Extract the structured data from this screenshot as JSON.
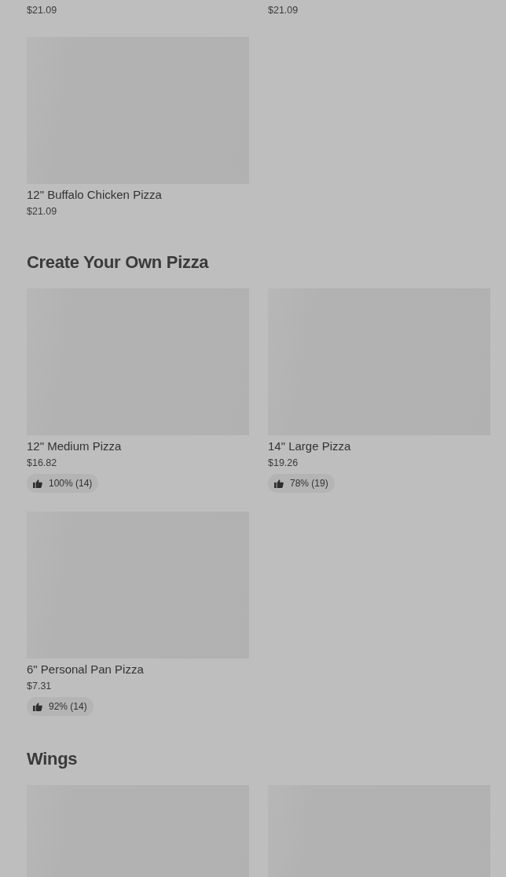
{
  "sections": [
    {
      "items": [
        {
          "image": false,
          "price": "$21.09"
        },
        {
          "image": false,
          "price": "$21.09"
        },
        {
          "image": true,
          "title": "12\" Buffalo Chicken Pizza",
          "price": "$21.09"
        }
      ]
    },
    {
      "heading": "Create Your Own Pizza",
      "items": [
        {
          "image": true,
          "title": "12\" Medium Pizza",
          "price": "$16.82",
          "rating": "100% (14)"
        },
        {
          "image": true,
          "title": "14\" Large Pizza",
          "price": "$19.26",
          "rating": "78% (19)"
        },
        {
          "image": true,
          "title": "6\" Personal Pan Pizza",
          "price": "$7.31",
          "rating": "92% (14)"
        }
      ]
    },
    {
      "heading": "Wings",
      "items": [
        {
          "image": true
        },
        {
          "image": true
        }
      ]
    }
  ]
}
